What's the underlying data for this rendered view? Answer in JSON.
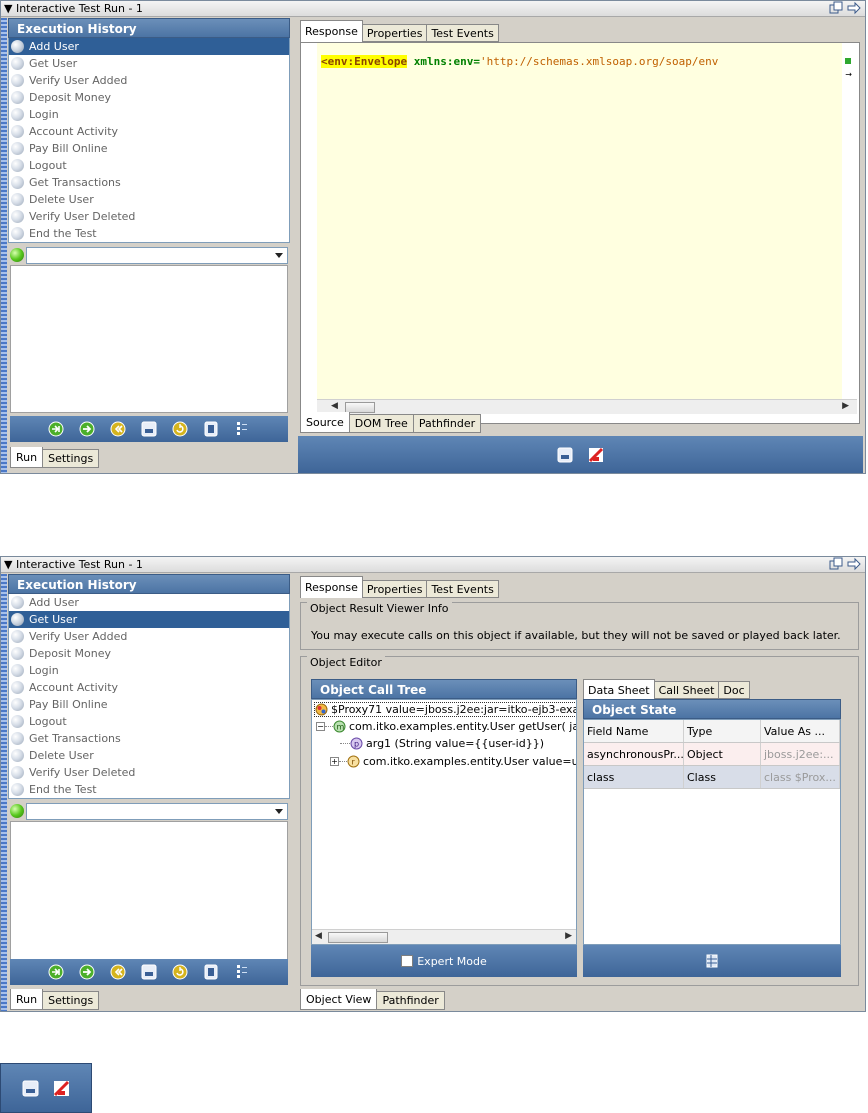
{
  "window_title": "▼ Interactive Test Run - 1",
  "execution_history": {
    "header": "Execution History",
    "items": [
      {
        "label": "Add User"
      },
      {
        "label": "Get User"
      },
      {
        "label": "Verify User Added"
      },
      {
        "label": "Deposit Money"
      },
      {
        "label": "Login"
      },
      {
        "label": "Account Activity"
      },
      {
        "label": "Pay Bill Online"
      },
      {
        "label": "Logout"
      },
      {
        "label": "Get Transactions"
      },
      {
        "label": "Delete User"
      },
      {
        "label": "Verify User Deleted"
      },
      {
        "label": "End the Test"
      }
    ],
    "selected_view1": "Add User",
    "selected_view2": "Get User"
  },
  "left_bottom_tabs": [
    "Run",
    "Settings"
  ],
  "right_tabs": [
    "Response",
    "Properties",
    "Test Events"
  ],
  "source_view": {
    "code_tag": "<env:Envelope",
    "code_attr": " xmlns:env=",
    "code_value": "'http://schemas.xmlsoap.org/soap/env",
    "bottom_tabs": [
      "Source",
      "DOM Tree",
      "Pathfinder"
    ]
  },
  "object_view": {
    "info_group_label": "Object Result Viewer Info",
    "info_text": "You may execute calls on this object if available, but they will not be saved or played back later.",
    "editor_group_label": "Object Editor",
    "call_tree": {
      "header": "Object Call Tree",
      "root": "$Proxy71 value=jboss.j2ee:jar=itko-ejb3-exam",
      "method": "com.itko.examples.entity.User getUser( jav",
      "arg": "arg1 (String value={{user-id}})",
      "result": "com.itko.examples.entity.User value=u",
      "expert_mode_label": "Expert Mode"
    },
    "state_tabs": [
      "Data Sheet",
      "Call Sheet",
      "Doc"
    ],
    "object_state": {
      "header": "Object State",
      "columns": [
        "Field Name",
        "Type",
        "Value As ..."
      ],
      "rows": [
        {
          "field": "asynchronousPr...",
          "type": "Object",
          "value": "jboss.j2ee:..."
        },
        {
          "field": "class",
          "type": "Class",
          "value": "class $Prox..."
        }
      ]
    },
    "bottom_tabs": [
      "Object View",
      "Pathfinder"
    ]
  },
  "icons": {
    "toolbar_left": [
      "step-into-icon",
      "run-icon",
      "rewind-icon",
      "save-icon",
      "refresh-icon",
      "delete-icon",
      "options-icon"
    ],
    "response_toolbar": [
      "save-icon",
      "no-edit-icon"
    ]
  },
  "colors": {
    "accent": "#2f5f97",
    "header_bar": "#4c74a4",
    "xml_tag_highlight": "#ffff00",
    "xml_attr": "#008000",
    "xml_value": "#c06000"
  }
}
